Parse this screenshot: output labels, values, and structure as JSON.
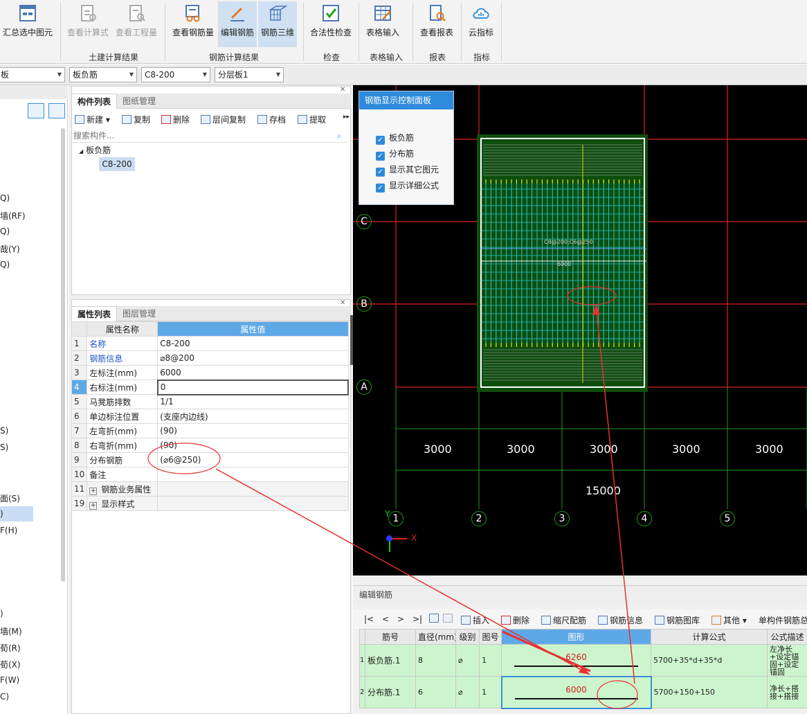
{
  "ribbon": {
    "buttons": [
      {
        "label": "汇总选中图元"
      },
      {
        "label": "查看计算式"
      },
      {
        "label": "查看工程量"
      },
      {
        "label": "查看钢筋量"
      },
      {
        "label": "编辑钢筋"
      },
      {
        "label": "钢筋三维"
      },
      {
        "label": "合法性检查"
      },
      {
        "label": "表格输入"
      },
      {
        "label": "查看报表"
      },
      {
        "label": "云指标"
      }
    ],
    "groups": [
      "土建计算结果",
      "钢筋计算结果",
      "检查",
      "表格输入",
      "报表",
      "指标"
    ]
  },
  "combos": [
    "板",
    "板负筋",
    "C8-200",
    "分层板1"
  ],
  "left_tree": [
    "Q)",
    "墙(RF)",
    "Q)",
    "哉(Y)",
    "Q)",
    "S)",
    "S)",
    "面(S)",
    ")",
    "F(H)",
    ")",
    "墙(M)",
    "荀(R)",
    "荀(X)",
    "F(W)",
    "C)"
  ],
  "component_panel": {
    "tabs": [
      "构件列表",
      "图纸管理"
    ],
    "toolbar": [
      "新建",
      "复制",
      "删除",
      "层间复制",
      "存档",
      "提取"
    ],
    "search_placeholder": "搜索构件...",
    "tree_root": "板负筋",
    "tree_child": "C8-200"
  },
  "property_panel": {
    "tabs": [
      "属性列表",
      "图层管理"
    ],
    "col_name": "属性名称",
    "col_value": "属性值",
    "rows": [
      {
        "num": "1",
        "name": "名称",
        "value": "C8-200"
      },
      {
        "num": "2",
        "name": "钢筋信息",
        "value": "⌀8@200"
      },
      {
        "num": "3",
        "name": "左标注(mm)",
        "value": "6000"
      },
      {
        "num": "4",
        "name": "右标注(mm)",
        "value": "0"
      },
      {
        "num": "5",
        "name": "马凳筋排数",
        "value": "1/1"
      },
      {
        "num": "6",
        "name": "单边标注位置",
        "value": "(支座内边线)"
      },
      {
        "num": "7",
        "name": "左弯折(mm)",
        "value": "(90)"
      },
      {
        "num": "8",
        "name": "右弯折(mm)",
        "value": "(90)"
      },
      {
        "num": "9",
        "name": "分布钢筋",
        "value": "(⌀6@250)"
      },
      {
        "num": "10",
        "name": "备注",
        "value": ""
      },
      {
        "num": "11",
        "name": "钢筋业务属性",
        "value": ""
      },
      {
        "num": "19",
        "name": "显示样式",
        "value": ""
      }
    ]
  },
  "control_panel": {
    "title": "钢筋显示控制面板",
    "items": [
      "板负筋",
      "分布筋",
      "显示其它图元",
      "显示详细公式"
    ]
  },
  "canvas": {
    "row_axes": [
      "C",
      "B",
      "A"
    ],
    "col_axes": [
      "1",
      "2",
      "3",
      "4",
      "5"
    ],
    "spans": [
      "3000",
      "3000",
      "3000",
      "3000",
      "3000"
    ],
    "total": "15000",
    "dim_label": "6000",
    "rebar_label": "C8@200;C6@250",
    "axis_y": "Y",
    "axis_x": "X"
  },
  "edit_rebar": {
    "title": "编辑钢筋",
    "toolbar": [
      "|<",
      "<",
      ">",
      ">|",
      "插入",
      "删除",
      "缩尺配筋",
      "钢筋信息",
      "钢筋图库",
      "其他",
      "单构件钢筋总"
    ],
    "headers": [
      "筋号",
      "直径(mm)",
      "级别",
      "图号",
      "图形",
      "计算公式",
      "公式描述"
    ],
    "rows": [
      {
        "idx": "1",
        "name": "板负筋.1",
        "dia": "8",
        "grade": "⌀",
        "fig": "1",
        "len": "6260",
        "formula": "5700+35*d+35*d",
        "desc": "左净长+设定锚固+设定锚固"
      },
      {
        "idx": "2",
        "name": "分布筋.1",
        "dia": "6",
        "grade": "⌀",
        "fig": "1",
        "len": "6000",
        "formula": "5700+150+150",
        "desc": "净长+搭接+搭接"
      }
    ]
  },
  "colors": {
    "accent": "#2e8bdc",
    "canvas_bg": "#000000",
    "grid_red": "#e02020",
    "grid_green": "#16a016",
    "rebar_cyan": "#22c8d8",
    "annotation": "#e83030"
  }
}
